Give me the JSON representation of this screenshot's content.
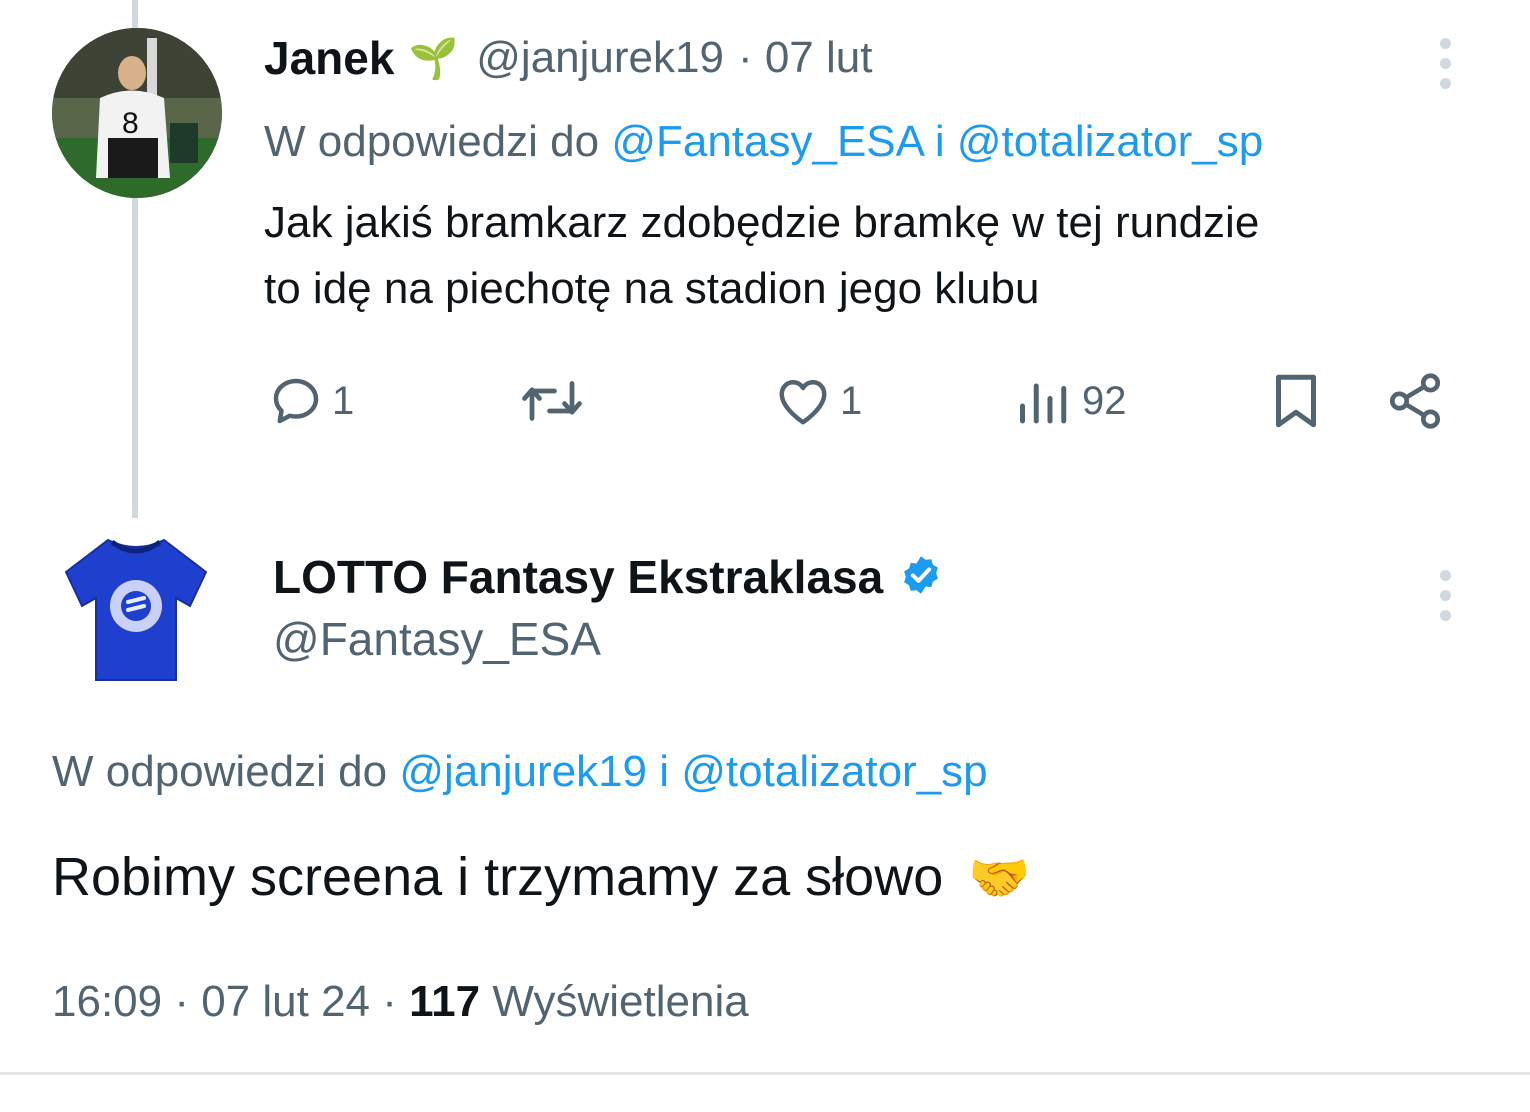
{
  "reply_tweet": {
    "display_name": "Janek",
    "name_emoji": "🌱",
    "handle": "@janjurek19",
    "date": "· 07 lut",
    "replying_prefix": "W odpowiedzi do",
    "replying_to_1": "@Fantasy_ESA",
    "replying_join": "i",
    "replying_to_2": "@totalizator_sp",
    "text_line_1": "Jak jakiś bramkarz zdobędzie bramkę w tej rundzie",
    "text_line_2": "to idę na piechotę na stadion jego klubu",
    "avatar_jersey_number": "8",
    "actions": {
      "replies": "1",
      "retweets": "",
      "likes": "1",
      "views": "92"
    }
  },
  "main_tweet": {
    "display_name": "LOTTO Fantasy Ekstraklasa",
    "verified": true,
    "handle": "@Fantasy_ESA",
    "replying_prefix": "W odpowiedzi do",
    "replying_to_1": "@janjurek19",
    "replying_join": "i",
    "replying_to_2": "@totalizator_sp",
    "text": "Robimy screena i trzymamy za słowo",
    "text_emoji": "🤝",
    "timestamp": "16:09 · 07 lut 24 ·",
    "views_count": "117",
    "views_label": "Wyświetlenia"
  },
  "colors": {
    "link": "#1d9bf0",
    "muted": "#536471",
    "verified": "#1d9bf0",
    "shirt": "#1f3fcf"
  },
  "icons": [
    "reply-icon",
    "retweet-icon",
    "like-icon",
    "views-icon",
    "bookmark-icon",
    "share-icon",
    "more-icon",
    "verified-icon"
  ]
}
